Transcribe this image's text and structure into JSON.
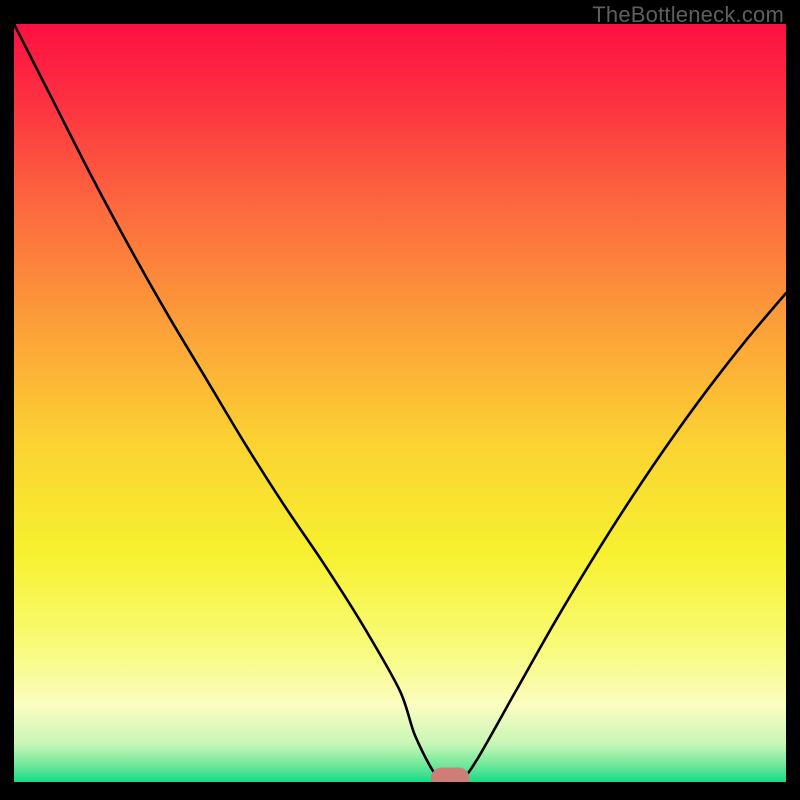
{
  "watermark": "TheBottleneck.com",
  "chart_data": {
    "type": "line",
    "title": "",
    "xlabel": "",
    "ylabel": "",
    "xlim": [
      0,
      100
    ],
    "ylim": [
      0,
      100
    ],
    "series": [
      {
        "name": "curve",
        "x": [
          0,
          5,
          10,
          15,
          20,
          25,
          30,
          35,
          40,
          45,
          50,
          52,
          55,
          58,
          60,
          65,
          70,
          75,
          80,
          85,
          90,
          95,
          100
        ],
        "y": [
          100,
          90,
          80,
          70.5,
          61.5,
          53,
          44.5,
          36.5,
          29,
          21,
          12,
          6,
          0.5,
          0.5,
          3,
          12,
          21,
          29.5,
          37.5,
          45,
          52,
          58.5,
          64.5
        ]
      }
    ],
    "marker": {
      "name": "optimal-marker",
      "x": 56.5,
      "y": 0.5,
      "w": 5.0,
      "h": 2.8,
      "color": "#cd7e76"
    },
    "gradient_stops": [
      {
        "offset": 0.0,
        "color": "#fd1041"
      },
      {
        "offset": 0.1,
        "color": "#fd3041"
      },
      {
        "offset": 0.25,
        "color": "#fd6c3e"
      },
      {
        "offset": 0.4,
        "color": "#fca039"
      },
      {
        "offset": 0.55,
        "color": "#fbd232"
      },
      {
        "offset": 0.7,
        "color": "#f7f12f"
      },
      {
        "offset": 0.82,
        "color": "#f8fb78"
      },
      {
        "offset": 0.9,
        "color": "#fafdc0"
      },
      {
        "offset": 0.95,
        "color": "#c7f6b6"
      },
      {
        "offset": 0.975,
        "color": "#7ae99d"
      },
      {
        "offset": 1.0,
        "color": "#16db88"
      }
    ]
  }
}
